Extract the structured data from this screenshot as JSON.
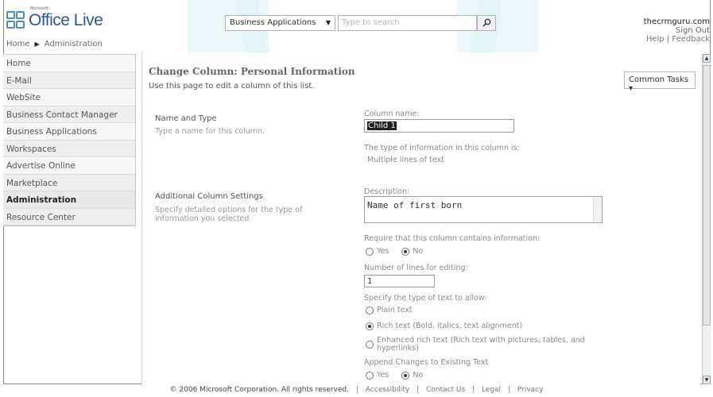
{
  "header": {
    "logo_small": "Microsoft",
    "logo_name": "Office Live",
    "search_scope": "Business Applications",
    "search_placeholder": "Type to search",
    "domain": "thecrmguru.com",
    "sign_out": "Sign Out",
    "help": "Help",
    "link_sep": "|",
    "feedback": "Feedback"
  },
  "breadcrumb": {
    "home": "Home",
    "current": "Administration"
  },
  "sidebar": {
    "items": [
      {
        "label": "Home"
      },
      {
        "label": "E-Mail"
      },
      {
        "label": "WebSite"
      },
      {
        "label": "Business Contact Manager"
      },
      {
        "label": "Business Applications"
      },
      {
        "label": "Workspaces"
      },
      {
        "label": "Advertise Online"
      },
      {
        "label": "Marketplace"
      },
      {
        "label": "Administration"
      },
      {
        "label": "Resource Center"
      }
    ]
  },
  "main": {
    "title": "Change Column: Personal Information",
    "subtitle": "Use this page to edit a column of this list.",
    "common_tasks": "Common Tasks ▾",
    "name_type": {
      "title": "Name and Type",
      "desc": "Type a name for this column.",
      "column_name_label": "Column name:",
      "column_name_value": "Child 1",
      "type_label": "The type of information in this column is:",
      "type_value": "Multiple lines of text"
    },
    "additional": {
      "title": "Additional Column Settings",
      "desc": "Specify detailed options for the type of information you selected.",
      "description_label": "Description:",
      "description_value": "Name of first born",
      "require_label": "Require that this column contains information:",
      "require_yes": "Yes",
      "require_no": "No",
      "lines_label": "Number of lines for editing:",
      "lines_value": "1",
      "text_type_label": "Specify the type of text to allow:",
      "plain_text": "Plain text",
      "rich_text": "Rich text (Bold, italics, text alignment)",
      "enhanced_text": "Enhanced rich text (Rich text with pictures, tables, and hyperlinks)",
      "append_label": "Append Changes to Existing Text",
      "append_yes": "Yes",
      "append_no": "No"
    }
  },
  "footer": {
    "copyright": "© 2006 Microsoft Corporation. All rights reserved.",
    "sep": "|",
    "accessibility": "Accessibility",
    "contact": "Contact Us",
    "legal": "Legal",
    "privacy": "Privacy"
  },
  "icons": {
    "search": "search-icon",
    "dropdown": "chevron-down-icon",
    "breadcrumb_separator": "triangle-right-icon"
  },
  "colors": {
    "brand_blue": "#2b5797",
    "watermark": "#d9f1f2"
  }
}
